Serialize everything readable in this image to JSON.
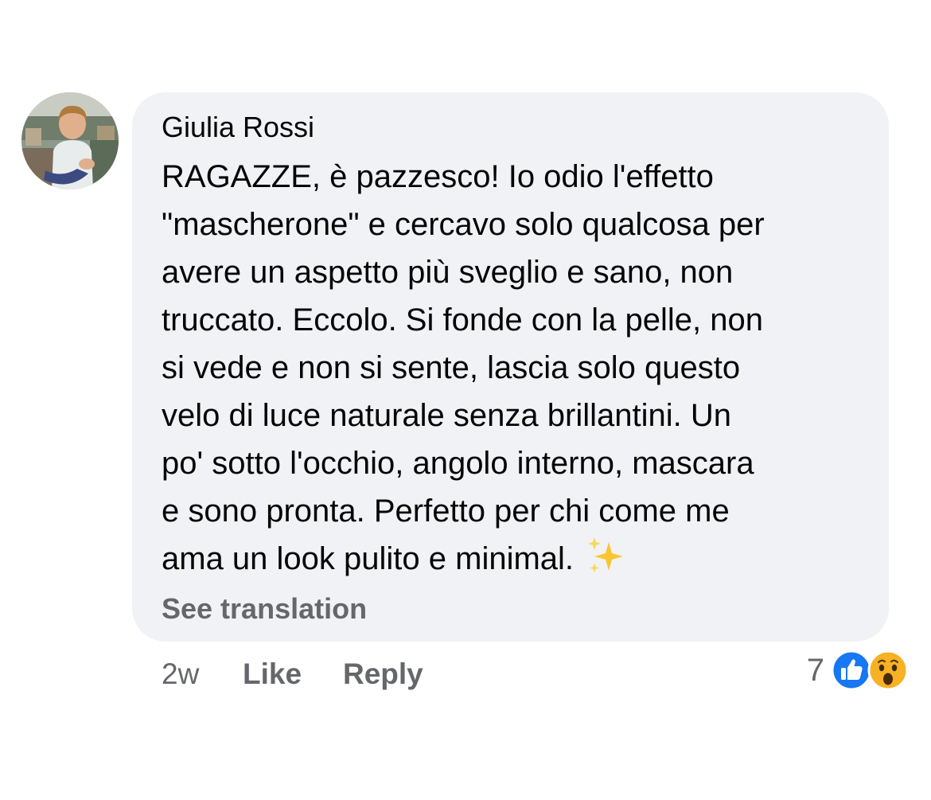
{
  "comment": {
    "author": "Giulia Rossi",
    "avatar_icon": "user-avatar-photo",
    "text_lines": [
      "RAGAZZE, è pazzesco! Io odio l'effetto",
      "\"mascherone\" e cercavo solo qualcosa per",
      "avere un aspetto più sveglio e sano, non",
      "truccato. Eccolo. Si fonde con la pelle, non",
      "si vede e non si sente, lascia solo questo",
      "velo di luce naturale senza brillantini. Un",
      "po' sotto l'occhio, angolo interno, mascara",
      "e sono pronta. Perfetto per chi come me",
      "ama un look pulito e minimal."
    ],
    "trailing_emoji": "sparkles-emoji",
    "see_translation": "See translation"
  },
  "actions": {
    "time": "2w",
    "like": "Like",
    "reply": "Reply"
  },
  "reactions": {
    "count": "7",
    "icons": [
      "like-reaction-icon",
      "wow-reaction-icon"
    ],
    "colors": {
      "like": "#1877f2",
      "wow": "#f7b125"
    }
  },
  "colors": {
    "bubble_bg": "#f0f2f5",
    "secondary_text": "#65676b",
    "primary_text": "#050505"
  }
}
